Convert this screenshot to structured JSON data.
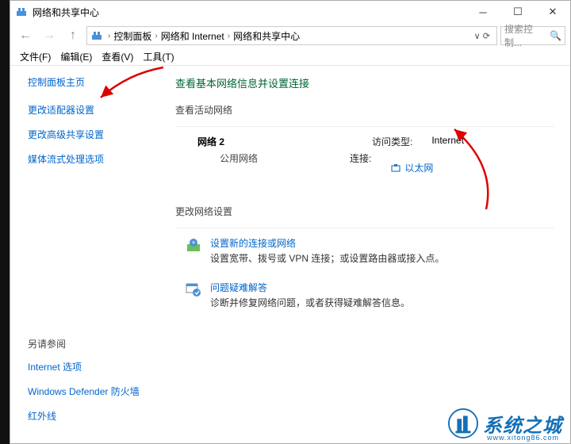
{
  "titlebar": {
    "title": "网络和共享中心"
  },
  "breadcrumb": {
    "items": [
      "控制面板",
      "网络和 Internet",
      "网络和共享中心"
    ]
  },
  "search": {
    "placeholder": "搜索控制..."
  },
  "menubar": {
    "file": "文件(F)",
    "edit": "编辑(E)",
    "view": "查看(V)",
    "tools": "工具(T)"
  },
  "sidebar": {
    "home": "控制面板主页",
    "links": [
      "更改适配器设置",
      "更改高级共享设置",
      "媒体流式处理选项"
    ],
    "related_title": "另请参阅",
    "related": [
      "Internet 选项",
      "Windows Defender 防火墙",
      "红外线"
    ]
  },
  "content": {
    "heading": "查看基本网络信息并设置连接",
    "active_title": "查看活动网络",
    "network": {
      "name": "网络 2",
      "type": "公用网络",
      "access_label": "访问类型:",
      "access_value": "Internet",
      "conn_label": "连接:",
      "conn_value": "以太网"
    },
    "change_title": "更改网络设置",
    "tasks": [
      {
        "title": "设置新的连接或网络",
        "desc": "设置宽带、拨号或 VPN 连接；或设置路由器或接入点。"
      },
      {
        "title": "问题疑难解答",
        "desc": "诊断并修复网络问题，或者获得疑难解答信息。"
      }
    ]
  },
  "watermark": {
    "text": "系统之城",
    "url": "www.xitong86.com"
  }
}
